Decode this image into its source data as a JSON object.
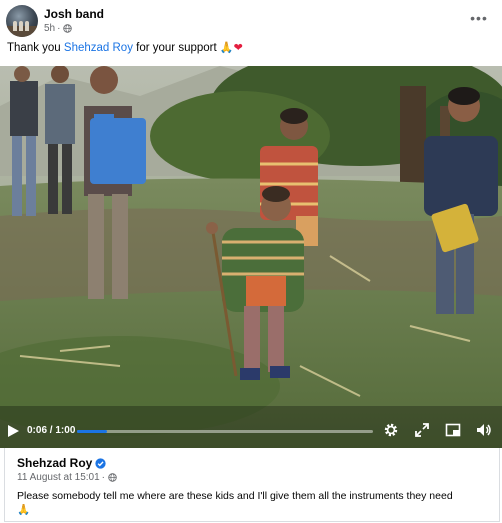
{
  "post": {
    "page_name": "Josh band",
    "time": "5h",
    "meta_separator": "·",
    "privacy_icon": "globe-icon",
    "more_icon": "more-options-icon",
    "more_label": "•••",
    "caption_before": "Thank you ",
    "caption_mention": "Shehzad Roy",
    "caption_after": " for your support ",
    "caption_emoji_pray": "🙏",
    "caption_emoji_heart": "❤"
  },
  "video": {
    "current_time": "0:06",
    "duration": "1:00",
    "time_separator": " / ",
    "progress": 0.1,
    "accent_color": "#1b74e4",
    "icons": [
      "play-icon",
      "settings-icon",
      "fullscreen-icon",
      "picture-in-picture-icon",
      "volume-icon"
    ]
  },
  "shared_post": {
    "author": "Shehzad Roy",
    "verified_icon": "verified-badge-icon",
    "date": "11 August at 15:01",
    "meta_separator": "·",
    "privacy_icon": "globe-icon",
    "text": "Please somebody tell me where are these kids and I'll give them all the instruments they need",
    "text_emoji": "🙏"
  }
}
